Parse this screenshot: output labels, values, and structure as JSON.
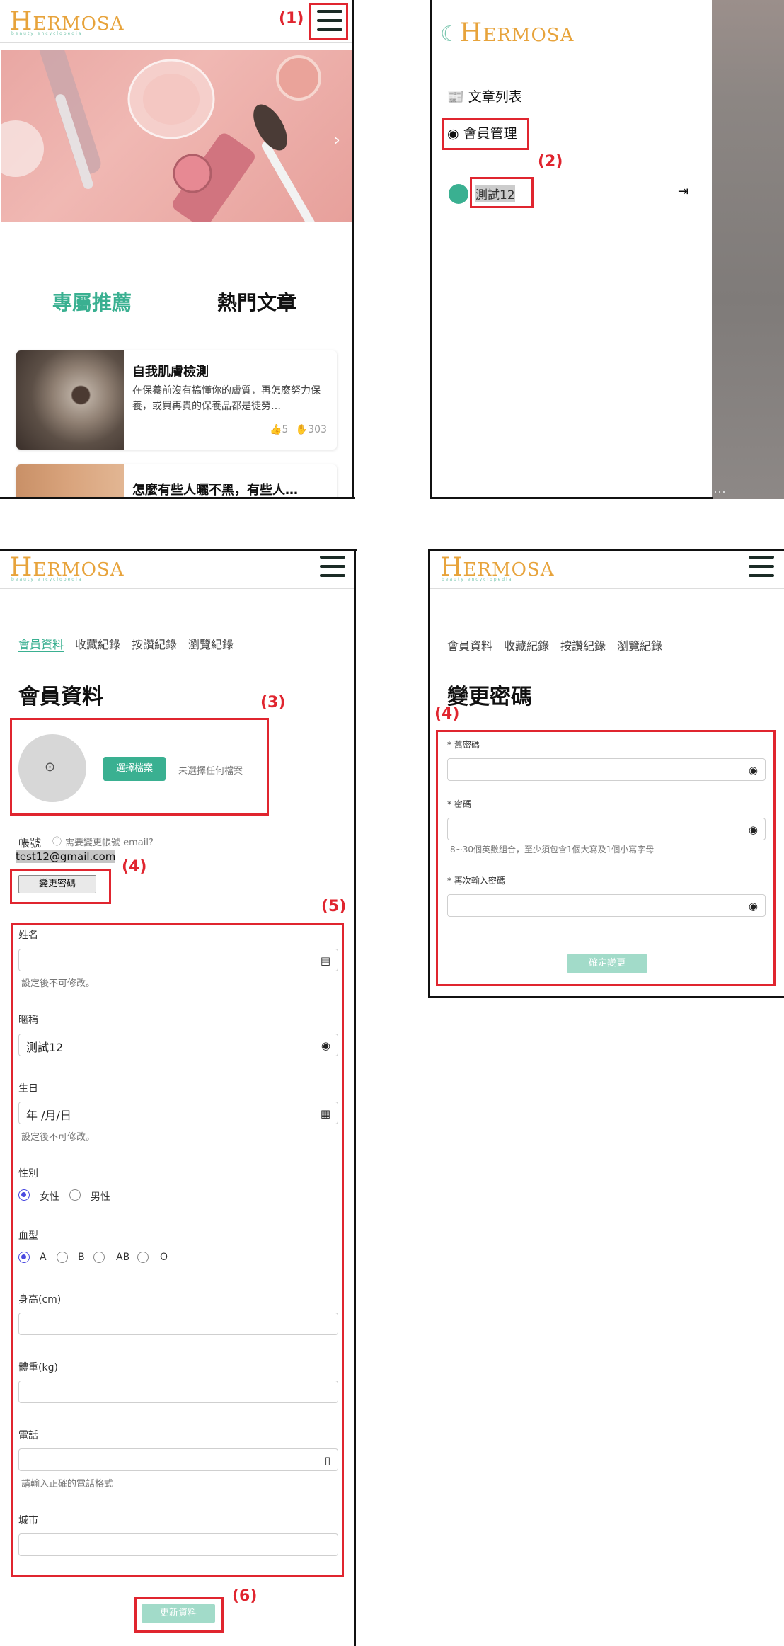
{
  "brand": {
    "logo_text_h": "H",
    "logo_text_rest": "ERMOSA",
    "tagline": "beauty encyclopedia",
    "accent": "#3ab091",
    "logo_color": "#e7a33b",
    "annotation_color": "#e0252f"
  },
  "annotations": [
    "(1)",
    "(2)",
    "(3)",
    "(4)",
    "(5)",
    "(6)",
    "(4)"
  ],
  "home": {
    "tabs": [
      "專屬推薦",
      "熱門文章"
    ],
    "articles": [
      {
        "title": "自我肌膚檢測",
        "excerpt": "在保養前沒有搞懂你的膚質，再怎麼努力保養，或買再貴的保養品都是徒勞…",
        "likes": "5",
        "views": "303"
      },
      {
        "title": "怎麼有些人曬不黑，有些人…"
      }
    ]
  },
  "drawer": {
    "items": [
      {
        "label": "文章列表",
        "icon": "book-icon"
      },
      {
        "label": "會員管理",
        "icon": "user-circle-icon"
      }
    ],
    "user_name": "測試12",
    "logout_icon": "logout-icon",
    "overlay_text": "…"
  },
  "member_tabs": [
    "會員資料",
    "收藏紀錄",
    "按讚紀錄",
    "瀏覽紀錄"
  ],
  "profile": {
    "title": "會員資料",
    "choose_file": "選擇檔案",
    "no_file": "未選擇任何檔案",
    "account_label": "帳號",
    "account_hint": "需要變更帳號 email?",
    "email": "test12@gmail.com",
    "change_password": "變更密碼",
    "fields": {
      "name_label": "姓名",
      "name_hint": "設定後不可修改。",
      "nickname_label": "暱稱",
      "nickname_value": "測試12",
      "birthday_label": "生日",
      "birthday_placeholder": "年 /月/日",
      "birthday_hint": "設定後不可修改。",
      "gender_label": "性別",
      "gender_options": [
        "女性",
        "男性"
      ],
      "blood_label": "血型",
      "blood_options": [
        "A",
        "B",
        "AB",
        "O"
      ],
      "height_label": "身高(cm)",
      "weight_label": "體重(kg)",
      "phone_label": "電話",
      "phone_hint": "請輸入正確的電話格式",
      "city_label": "城市"
    },
    "submit": "更新資料"
  },
  "password": {
    "title": "變更密碼",
    "old_label": "* 舊密碼",
    "new_label": "* 密碼",
    "new_hint": "8~30個英數組合，至少須包含1個大寫及1個小寫字母",
    "confirm_label": "* 再次輸入密碼",
    "submit": "確定變更"
  }
}
